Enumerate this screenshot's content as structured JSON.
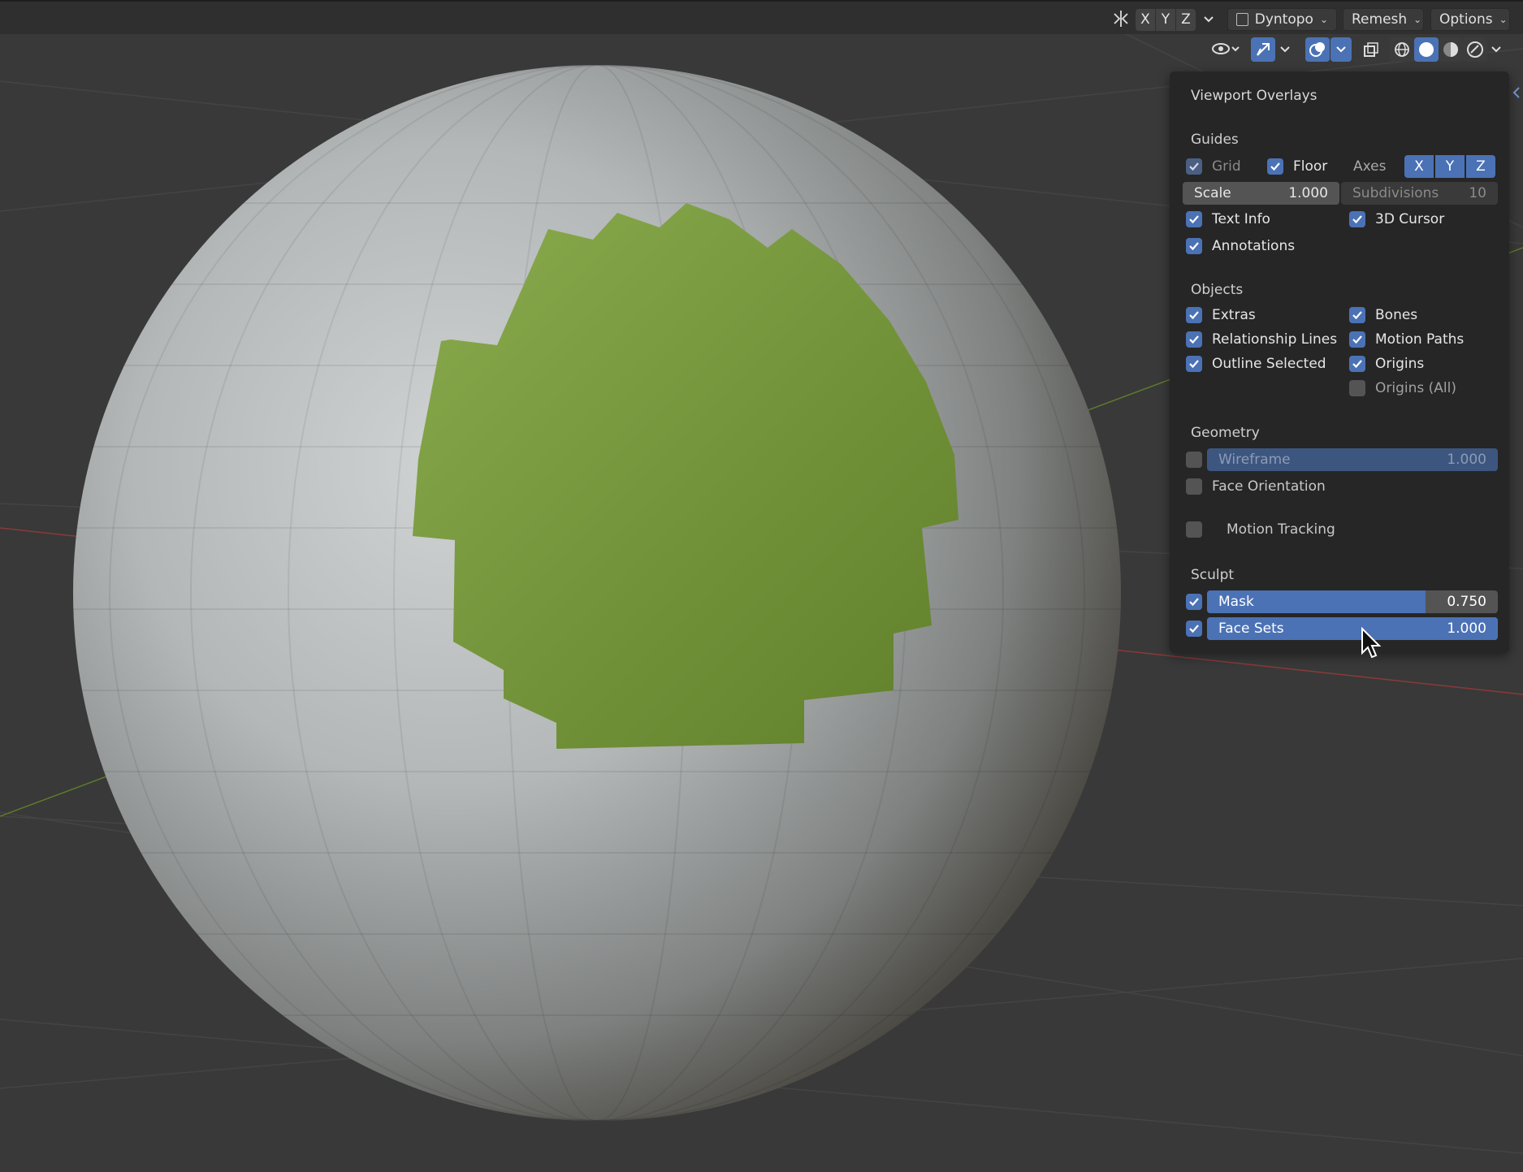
{
  "header": {
    "axis_labels": [
      "X",
      "Y",
      "Z"
    ],
    "dyntopo_label": "Dyntopo",
    "remesh_label": "Remesh",
    "options_label": "Options"
  },
  "overlays": {
    "title": "Viewport Overlays",
    "guides": {
      "label": "Guides",
      "grid": {
        "label": "Grid",
        "checked": true
      },
      "floor": {
        "label": "Floor",
        "checked": true
      },
      "axes_label": "Axes",
      "axes": [
        "X",
        "Y",
        "Z"
      ],
      "scale": {
        "label": "Scale",
        "value": "1.000"
      },
      "subdivisions": {
        "label": "Subdivisions",
        "value": "10"
      },
      "text_info": {
        "label": "Text Info",
        "checked": true
      },
      "cursor_3d": {
        "label": "3D Cursor",
        "checked": true
      },
      "annotations": {
        "label": "Annotations",
        "checked": true
      }
    },
    "objects": {
      "label": "Objects",
      "extras": {
        "label": "Extras",
        "checked": true
      },
      "bones": {
        "label": "Bones",
        "checked": true
      },
      "relationship_lines": {
        "label": "Relationship Lines",
        "checked": true
      },
      "motion_paths": {
        "label": "Motion Paths",
        "checked": true
      },
      "outline_selected": {
        "label": "Outline Selected",
        "checked": true
      },
      "origins": {
        "label": "Origins",
        "checked": true
      },
      "origins_all": {
        "label": "Origins (All)",
        "checked": false
      }
    },
    "geometry": {
      "label": "Geometry",
      "wireframe": {
        "label": "Wireframe",
        "value": "1.000",
        "checked": false
      },
      "face_orientation": {
        "label": "Face Orientation",
        "checked": false
      },
      "motion_tracking": {
        "label": "Motion Tracking",
        "checked": false
      }
    },
    "sculpt": {
      "label": "Sculpt",
      "mask": {
        "label": "Mask",
        "value": "0.750",
        "fraction": 0.75,
        "checked": true
      },
      "face_sets": {
        "label": "Face Sets",
        "value": "1.000",
        "fraction": 1.0,
        "checked": true
      }
    }
  },
  "colors": {
    "accent": "#4b72b5",
    "background": "#393939",
    "mask_green": "#7a9a3e",
    "sphere": "#b5b9b9"
  }
}
